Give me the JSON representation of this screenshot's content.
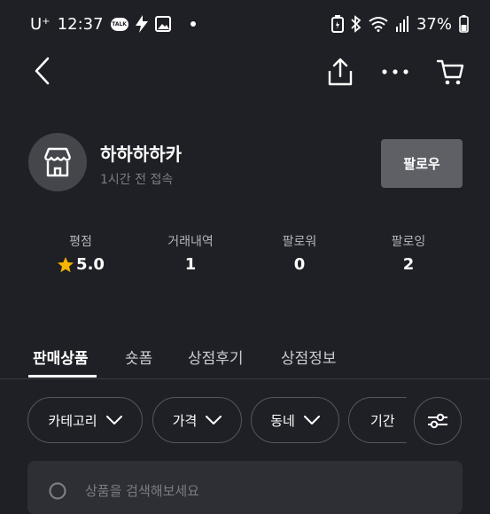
{
  "status_bar": {
    "carrier": "U⁺",
    "time": "12:37",
    "talk_badge": "TALK",
    "battery": "37%"
  },
  "app_bar": {
    "back_icon": "back-arrow-icon",
    "share_icon": "share-icon",
    "more_icon": "more-dots-icon",
    "cart_icon": "cart-icon"
  },
  "profile": {
    "store_name": "하하하하카",
    "last_access": "1시간 전 접속",
    "follow_label": "팔로우",
    "avatar_icon": "store-icon"
  },
  "stats": [
    {
      "label": "평점",
      "value": "5.0",
      "icon": "star-icon"
    },
    {
      "label": "거래내역",
      "value": "1"
    },
    {
      "label": "팔로워",
      "value": "0"
    },
    {
      "label": "팔로잉",
      "value": "2"
    }
  ],
  "tabs": [
    {
      "label": "판매상품",
      "active": true
    },
    {
      "label": "숏폼",
      "active": false
    },
    {
      "label": "상점후기",
      "active": false
    },
    {
      "label": "상점정보",
      "active": false
    }
  ],
  "filters": [
    {
      "label": "카테고리"
    },
    {
      "label": "가격"
    },
    {
      "label": "동네"
    },
    {
      "label": "기간"
    }
  ],
  "search": {
    "placeholder": "상품을 검색해보세요"
  },
  "colors": {
    "background": "#1f2025",
    "follow_button": "#5e6066",
    "star": "#f5b400"
  }
}
